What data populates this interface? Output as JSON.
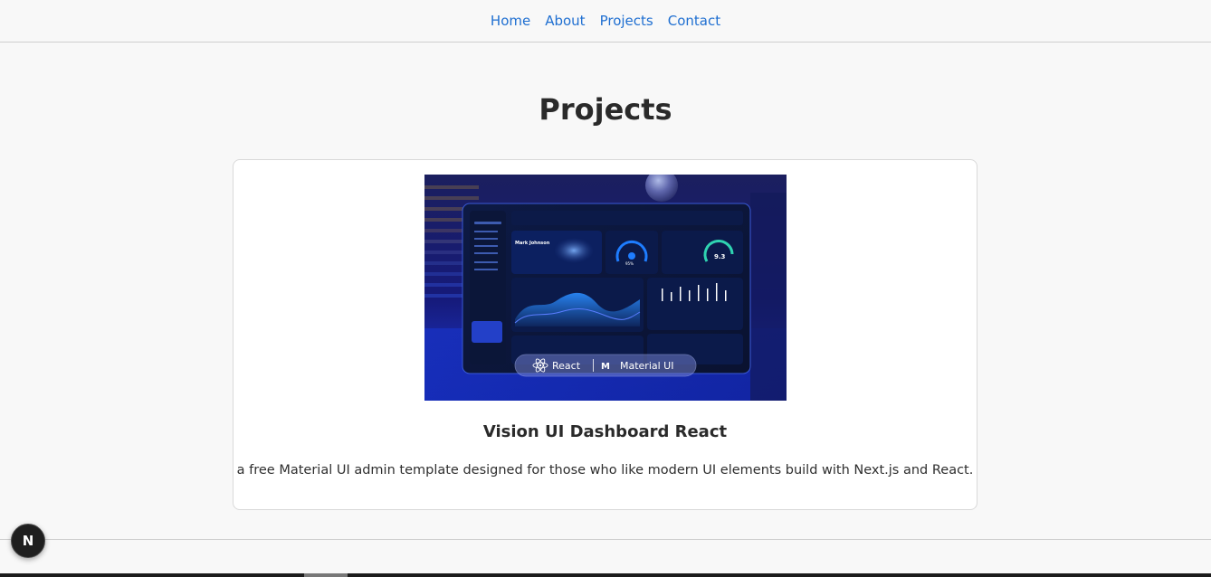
{
  "nav": {
    "links": [
      {
        "label": "Home"
      },
      {
        "label": "About"
      },
      {
        "label": "Projects"
      },
      {
        "label": "Contact"
      }
    ],
    "link_color": "#1f6fd1"
  },
  "page": {
    "title": "Projects"
  },
  "projects": [
    {
      "title": "Vision UI Dashboard React",
      "description": "a free Material UI admin template designed for those who like modern UI elements build with Next.js and React.",
      "image": {
        "profile_name": "Mark Johnson",
        "rating_value": "9.3",
        "percent_value": "95%",
        "badge_react": "React",
        "badge_mui": "Material UI"
      }
    }
  ],
  "dev_badge": {
    "letter": "N"
  }
}
